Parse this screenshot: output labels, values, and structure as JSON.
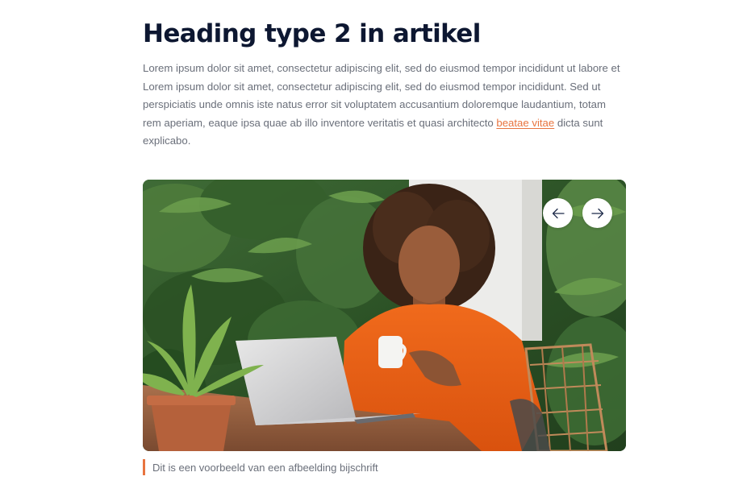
{
  "article": {
    "heading": "Heading type 2 in artikel",
    "paragraph_before_link": "Lorem ipsum dolor sit amet, consectetur adipiscing elit, sed do eiusmod tempor incididunt ut labore et Lorem ipsum dolor sit amet, consectetur adipiscing elit, sed do eiusmod tempor incididunt. Sed ut perspiciatis unde omnis iste natus error sit voluptatem accusantium doloremque laudantium, totam rem aperiam, eaque ipsa quae ab illo inventore veritatis et quasi architecto ",
    "link_text": "beatae vitae",
    "paragraph_after_link": " dicta sunt explicabo."
  },
  "slider": {
    "prev_icon": "arrow-left-icon",
    "next_icon": "arrow-right-icon",
    "caption": "Dit is een voorbeeld van een afbeelding bijschrift"
  },
  "colors": {
    "heading": "#0d1731",
    "body_text": "#6a6f7a",
    "accent": "#e8743f",
    "button_bg": "#ffffff"
  }
}
